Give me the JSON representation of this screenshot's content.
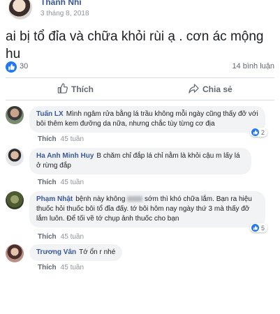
{
  "post": {
    "author": "Thanh Nhi",
    "date": "3 tháng 8, 2018",
    "text": "ai bị tổ đỉa và chữa khỏi rùi ạ . cơn ác mộng hu",
    "like_count": "30",
    "comment_count": "14 bình luận"
  },
  "actions": {
    "like_label": "Thích",
    "share_label": "Chia sẻ"
  },
  "comments": [
    {
      "name": "Tuấn LX",
      "text": "Mình ngâm rửa bằng lá trầu không mỗi ngày cũng thấy đỡ với bôi thêm kem đưỡng da nữa, nhưng chắc tùy từng cơ địa",
      "reply": "Thích",
      "time": "45 tuần",
      "reactions": "2"
    },
    {
      "name": "Ha Anh Minh Huy",
      "text": "B chăm chỉ đắp lá chỉ nằm là khỏi cậu m lấy lá ở rừng đắp",
      "reply": "Thích",
      "time": "45 tuần"
    },
    {
      "name": "Phạm Nhật",
      "text_before": "bệnh này không",
      "text_after": "sớm thì khó chữa lắm. Bạn ra hiệu thuốc hỏi thuốc bôi tổ đỉa đấy. tớ bôi hôm nay ngày thứ 3 mà thấy đỡ lắm luôn. Để tối về tớ chụp ảnh thuốc cho bạn",
      "reply": "Thích",
      "time": "45 tuần",
      "reactions": "5"
    },
    {
      "name": "Trương Vân",
      "text": "Tớ ổn r nhé",
      "reply": "Thích",
      "time": "45 tuần"
    }
  ],
  "colors": {
    "link": "#385898",
    "like_blue": "#2078f4",
    "bubble": "#f2f3f5"
  },
  "icons": [
    "more-options-icon",
    "like-reaction-icon",
    "thumbs-up-icon",
    "share-arrow-icon"
  ]
}
